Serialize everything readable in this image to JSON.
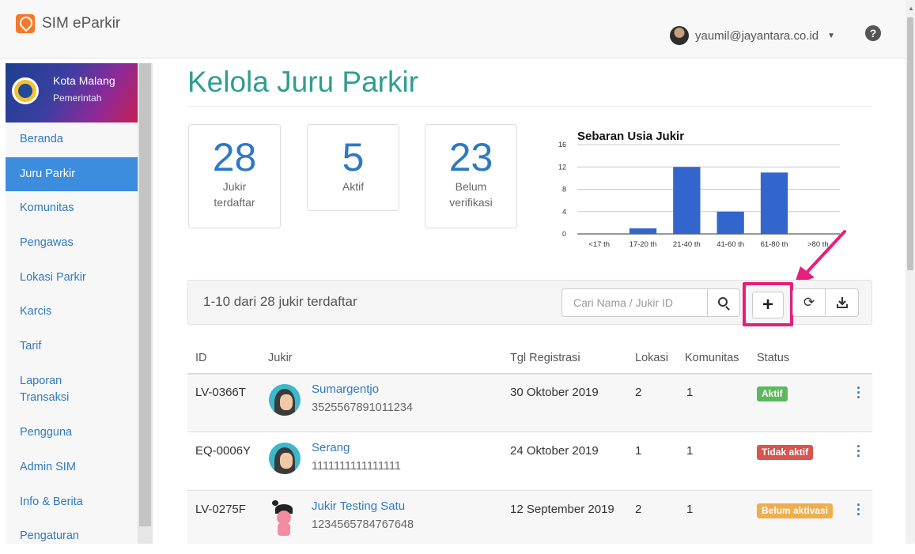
{
  "app": {
    "name": "SIM eParkir"
  },
  "user": {
    "email": "yaumil@jayantara.co.id"
  },
  "org": {
    "name": "Kota Malang",
    "sub": "Pemerintah"
  },
  "sidebar": {
    "items": [
      {
        "label": "Beranda"
      },
      {
        "label": "Juru Parkir"
      },
      {
        "label": "Komunitas"
      },
      {
        "label": "Pengawas"
      },
      {
        "label": "Lokasi Parkir"
      },
      {
        "label": "Karcis"
      },
      {
        "label": "Tarif"
      },
      {
        "label": "Laporan Transaksi"
      },
      {
        "label": "Pengguna"
      },
      {
        "label": "Admin SIM"
      },
      {
        "label": "Info & Berita"
      },
      {
        "label": "Pengaturan"
      }
    ]
  },
  "page": {
    "title": "Kelola Juru Parkir"
  },
  "stats": [
    {
      "value": "28",
      "label": "Jukir terdaftar"
    },
    {
      "value": "5",
      "label": "Aktif"
    },
    {
      "value": "23",
      "label": "Belum verifikasi"
    }
  ],
  "chart_data": {
    "type": "bar",
    "title": "Sebaran Usia Jukir",
    "categories": [
      "<17 th",
      "17-20 th",
      "21-40 th",
      "41-60 th",
      "61-80 th",
      ">80 th"
    ],
    "values": [
      0,
      1,
      12,
      4,
      11,
      0
    ],
    "ylim": [
      0,
      16
    ],
    "yticks": [
      "0",
      "4",
      "8",
      "12",
      "16"
    ],
    "grid": true,
    "color": "#3366cc"
  },
  "toolbar": {
    "count_text": "1-10 dari 28 jukir terdaftar",
    "search_placeholder": "Cari Nama / Jukir ID",
    "add_label": "+"
  },
  "table": {
    "headers": {
      "id": "ID",
      "jukir": "Jukir",
      "tgl": "Tgl Registrasi",
      "lokasi": "Lokasi",
      "komunitas": "Komunitas",
      "status": "Status"
    },
    "rows": [
      {
        "id": "LV-0366T",
        "name": "Sumargentjo",
        "nid": "3525567891011234",
        "tgl": "30 Oktober 2019",
        "lokasi": "2",
        "komunitas": "1",
        "status": "Aktif",
        "status_color": "#5cb85c"
      },
      {
        "id": "EQ-0006Y",
        "name": "Serang",
        "nid": "1111111111111111",
        "tgl": "24 Oktober 2019",
        "lokasi": "1",
        "komunitas": "1",
        "status": "Tidak aktif",
        "status_color": "#d9534f"
      },
      {
        "id": "LV-0275F",
        "name": "Jukir Testing Satu",
        "nid": "1234565784767648",
        "tgl": "12 September 2019",
        "lokasi": "2",
        "komunitas": "1",
        "status": "Belum aktivasi",
        "status_color": "#f0ad4e"
      }
    ]
  },
  "colors": {
    "accent": "#2e9e90",
    "link": "#2f7ac0",
    "highlight": "#e61f7a"
  }
}
